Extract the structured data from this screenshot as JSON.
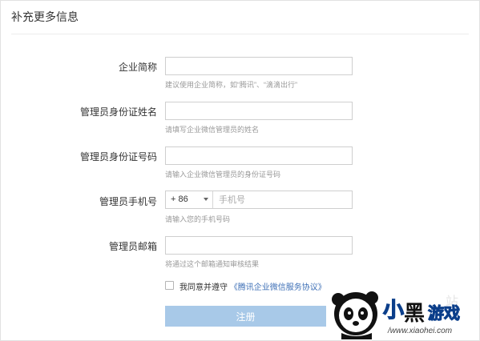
{
  "header": {
    "title": "补充更多信息"
  },
  "form": {
    "company_short": {
      "label": "企业简称",
      "value": "",
      "hint": "建议使用企业简称，如“腾讯”、“滴滴出行”"
    },
    "admin_name": {
      "label": "管理员身份证姓名",
      "value": "",
      "hint": "请填写企业微信管理员的姓名"
    },
    "admin_id": {
      "label": "管理员身份证号码",
      "value": "",
      "hint": "请输入企业微信管理员的身份证号码"
    },
    "admin_phone": {
      "label": "管理员手机号",
      "country_code": "+ 86",
      "placeholder": "手机号",
      "hint": "请输入您的手机号码"
    },
    "admin_email": {
      "label": "管理员邮箱",
      "value": "",
      "hint": "将通过这个邮箱通知审核结果"
    },
    "agreement": {
      "prefix": "我同意并遵守",
      "link_text": "《腾讯企业微信服务协议》",
      "checked": false
    },
    "submit_label": "注册"
  },
  "watermark": {
    "brand_text": "小黑游戏",
    "url_text": "www.xiaohei.com"
  },
  "colors": {
    "button_bg": "#a8c9e8",
    "link": "#3d6fb6",
    "hint": "#999999",
    "border": "#cfcfcf"
  }
}
